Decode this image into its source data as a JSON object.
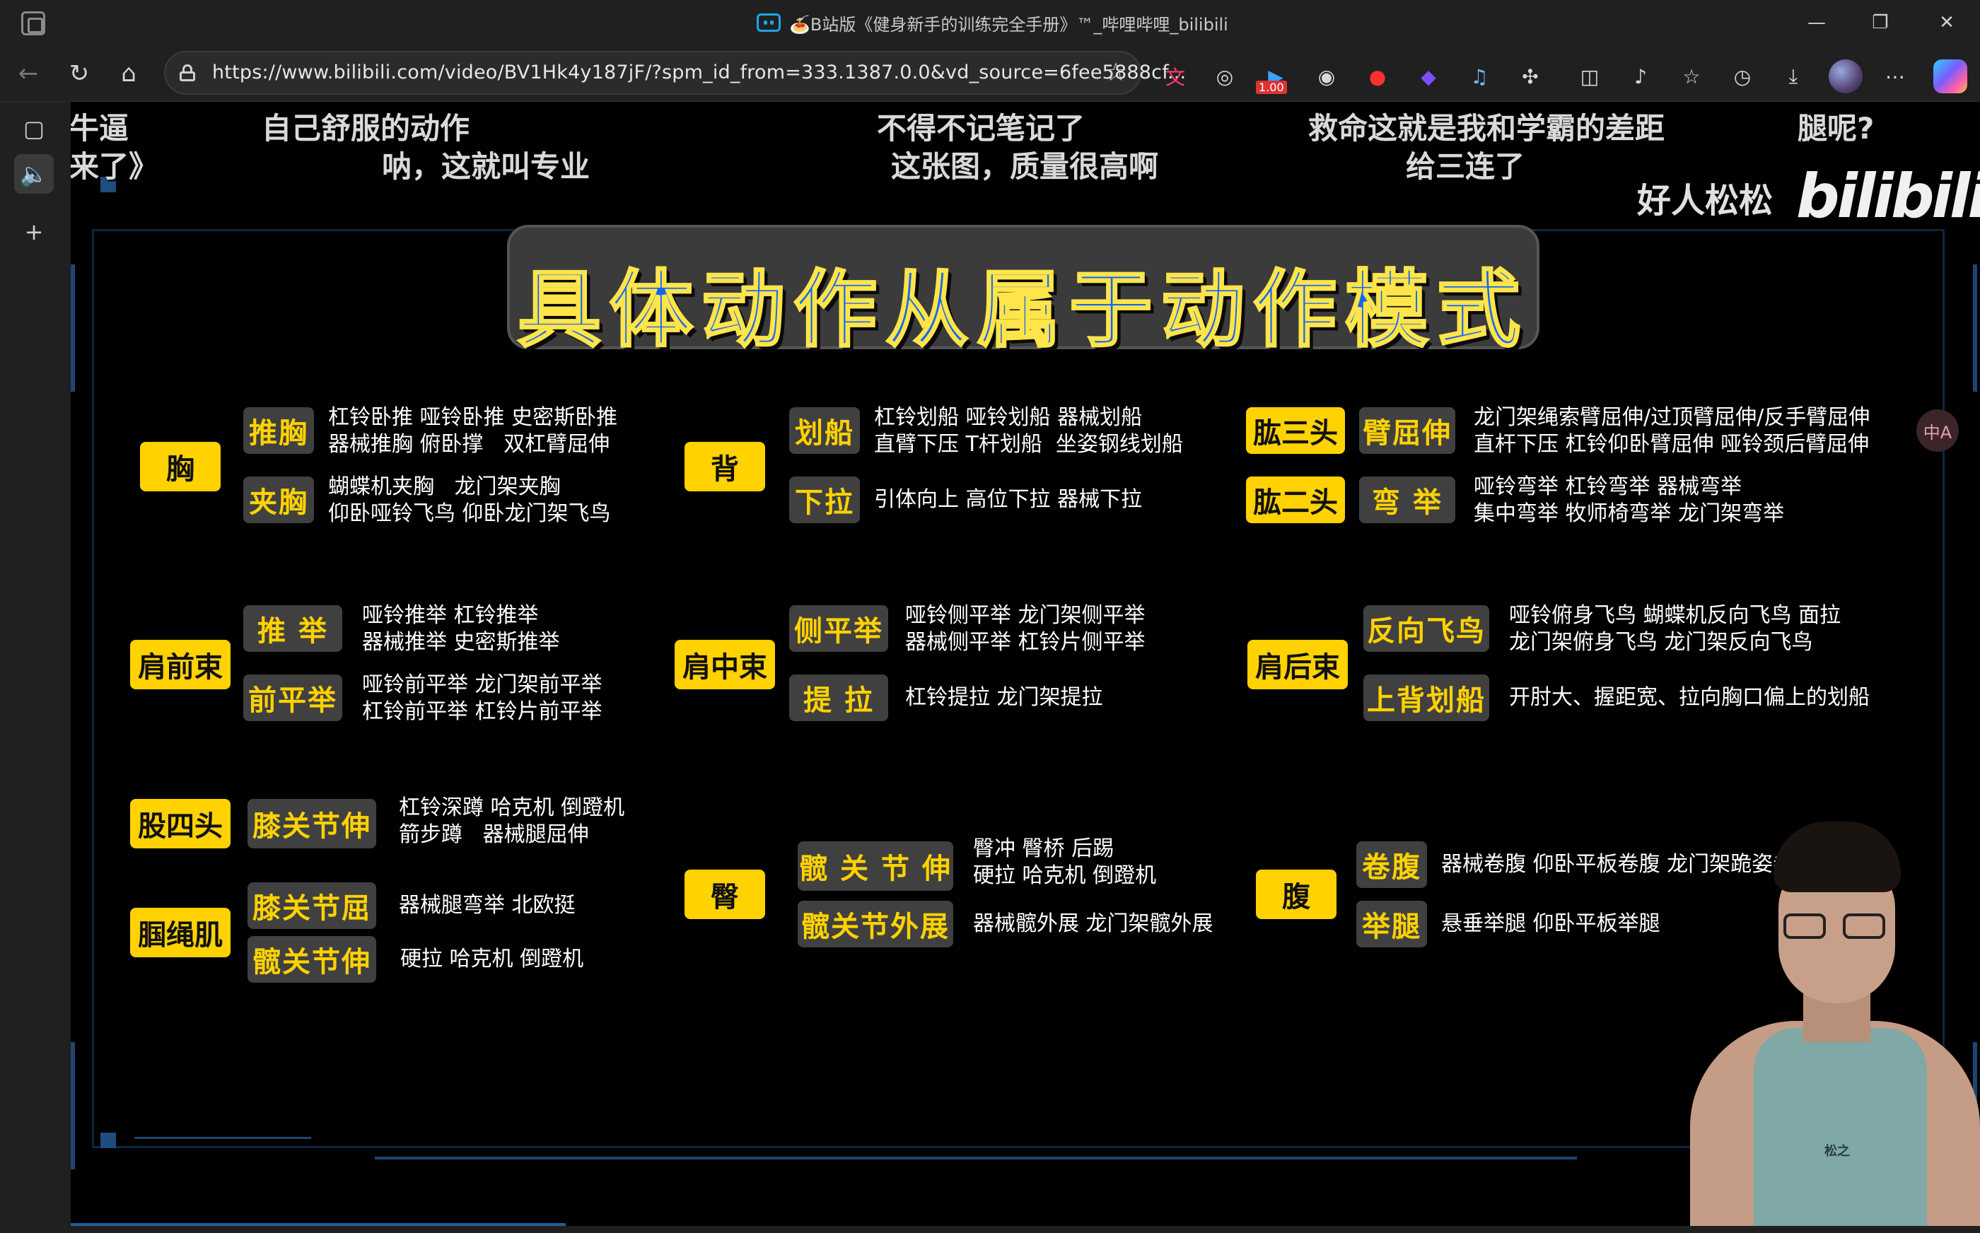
{
  "window": {
    "title": "🍝B站版《健身新手的训练完全手册》™_哔哩哔哩_bilibili",
    "controls": {
      "minimize": "—",
      "restore": "❐",
      "close": "✕"
    }
  },
  "toolbar": {
    "back_icon": "←",
    "refresh_icon": "↻",
    "home_icon": "⌂",
    "url": "https://www.bilibili.com/video/BV1Hk4y187jF/?spm_id_from=333.1387.0.0&vd_source=6fee5888cf...",
    "favorite_icon": "☆",
    "extension_badge": "1.00",
    "more_icon": "⋯"
  },
  "sidebar": {
    "tabs_icon": "▢",
    "audio_icon": "🔈",
    "add_icon": "+"
  },
  "video": {
    "danmaku": [
      "牛逼",
      "来了》",
      "自己舒服的动作",
      "呐，这就叫专业",
      "不得不记笔记了",
      "这张图，质量很高啊",
      "救命这就是我和学霸的差距",
      "给三连了",
      "腿呢?"
    ],
    "watermark": "好人松松",
    "logo": "bilibili",
    "heading": "具体动作从属于动作模式",
    "subtitle_badge": "中A",
    "shirt_logo": "松之",
    "groups": {
      "chest": {
        "category": "胸",
        "rows": [
          {
            "label": "推胸",
            "desc": "杠铃卧推 哑铃卧推 史密斯卧推\n器械推胸 俯卧撑   双杠臂屈伸"
          },
          {
            "label": "夹胸",
            "desc": "蝴蝶机夹胸   龙门架夹胸\n仰卧哑铃飞鸟 仰卧龙门架飞鸟"
          }
        ]
      },
      "back": {
        "category": "背",
        "rows": [
          {
            "label": "划船",
            "desc": "杠铃划船 哑铃划船 器械划船\n直臂下压 T杆划船  坐姿钢线划船"
          },
          {
            "label": "下拉",
            "desc": "引体向上 高位下拉 器械下拉"
          }
        ]
      },
      "arms": {
        "rows": [
          {
            "category": "肱三头",
            "label": "臂屈伸",
            "desc": "龙门架绳索臂屈伸/过顶臂屈伸/反手臂屈伸\n直杆下压 杠铃仰卧臂屈伸 哑铃颈后臂屈伸"
          },
          {
            "category": "肱二头",
            "label": "弯  举",
            "desc": "哑铃弯举 杠铃弯举 器械弯举\n集中弯举 牧师椅弯举 龙门架弯举"
          }
        ]
      },
      "front_delt": {
        "category": "肩前束",
        "rows": [
          {
            "label": "推  举",
            "desc": "哑铃推举 杠铃推举\n器械推举 史密斯推举"
          },
          {
            "label": "前平举",
            "desc": "哑铃前平举 龙门架前平举\n杠铃前平举 杠铃片前平举"
          }
        ]
      },
      "mid_delt": {
        "category": "肩中束",
        "rows": [
          {
            "label": "侧平举",
            "desc": "哑铃侧平举 龙门架侧平举\n器械侧平举 杠铃片侧平举"
          },
          {
            "label": "提  拉",
            "desc": "杠铃提拉 龙门架提拉"
          }
        ]
      },
      "rear_delt": {
        "category": "肩后束",
        "rows": [
          {
            "label": "反向飞鸟",
            "desc": "哑铃俯身飞鸟 蝴蝶机反向飞鸟 面拉\n龙门架俯身飞鸟 龙门架反向飞鸟"
          },
          {
            "label": "上背划船",
            "desc": "开肘大、握距宽、拉向胸口偏上的划船"
          }
        ]
      },
      "quads": {
        "category": "股四头",
        "rows": [
          {
            "label": "膝关节伸",
            "desc": "杠铃深蹲 哈克机 倒蹬机\n箭步蹲   器械腿屈伸"
          }
        ]
      },
      "hamstrings": {
        "category": "腘绳肌",
        "rows": [
          {
            "label": "膝关节屈",
            "desc": "器械腿弯举 北欧挺"
          },
          {
            "label": "髋关节伸",
            "desc": "硬拉 哈克机 倒蹬机"
          }
        ]
      },
      "glutes": {
        "category": "臀",
        "rows": [
          {
            "label": "髋 关 节 伸",
            "desc": "臀冲 臀桥 后踢\n硬拉 哈克机 倒蹬机"
          },
          {
            "label": "髋关节外展",
            "desc": "器械髋外展 龙门架髋外展"
          }
        ]
      },
      "abs": {
        "category": "腹",
        "rows": [
          {
            "label": "卷腹",
            "desc": "器械卷腹 仰卧平板卷腹 龙门架跪姿卷腹"
          },
          {
            "label": "举腿",
            "desc": "悬垂举腿 仰卧平板举腿"
          }
        ]
      }
    }
  },
  "colors": {
    "category_bg": "#ffd200",
    "label_bg": "#404040",
    "label_text": "#ffd200",
    "heading_fill": "#1565f5",
    "heading_stroke": "#ffe54a"
  }
}
